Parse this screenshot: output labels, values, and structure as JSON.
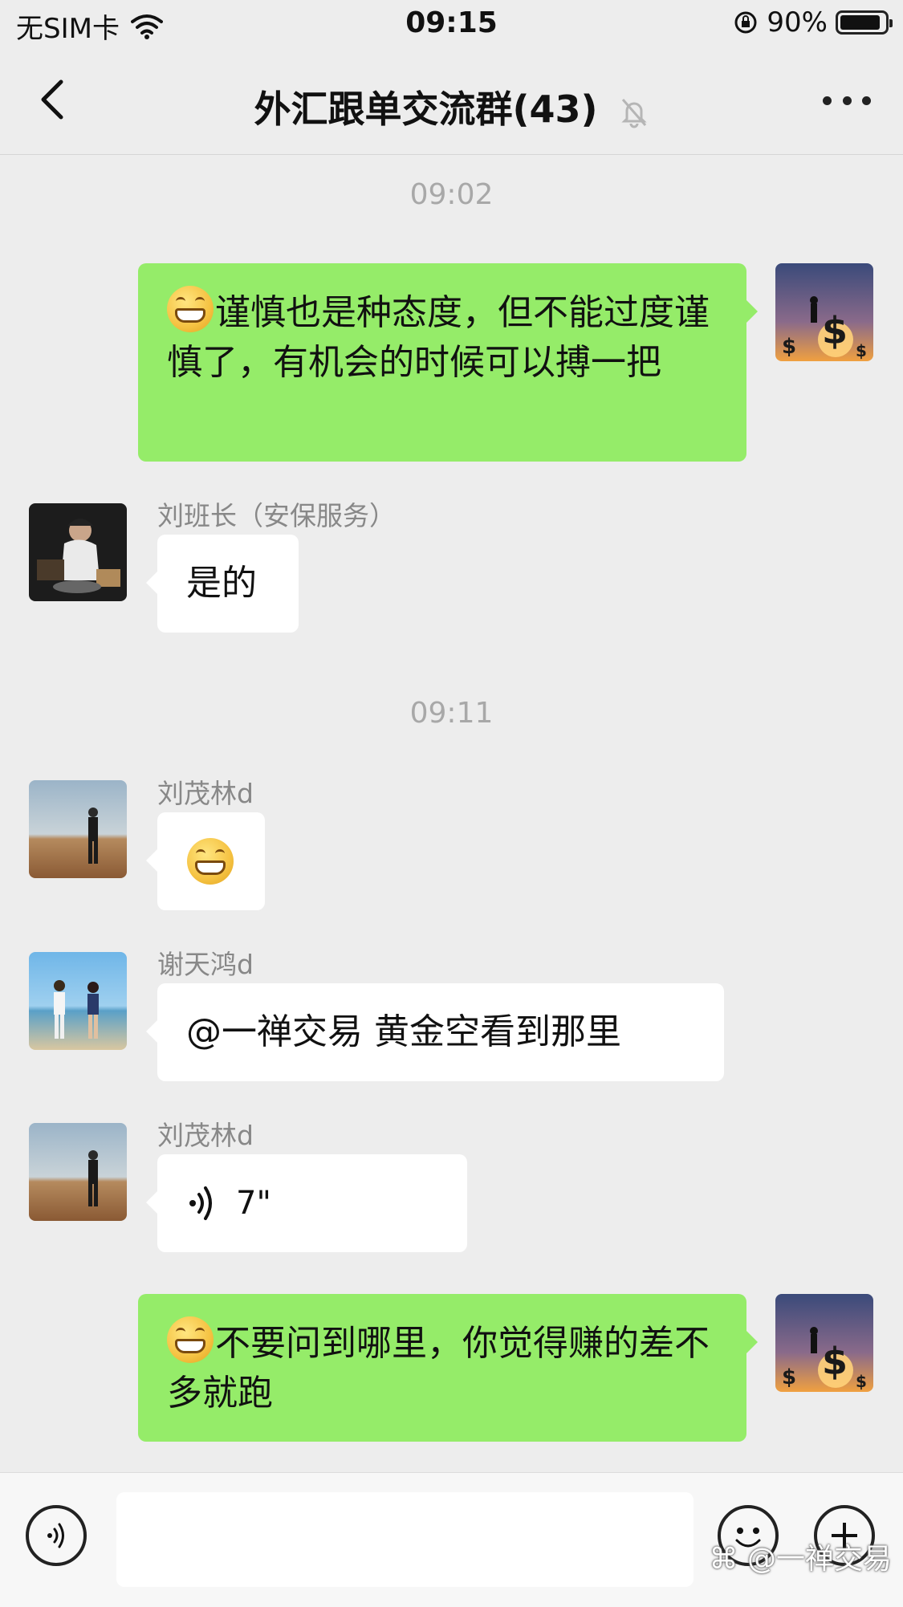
{
  "status_bar": {
    "carrier": "无SIM卡",
    "time": "09:15",
    "battery": "90%",
    "battery_level": 0.9
  },
  "nav": {
    "title": "外汇跟单交流群(43)"
  },
  "messages": {
    "ts1": "09:02",
    "m1_text": "谨慎也是种态度，但不能过度谨慎了，有机会的时候可以搏一把",
    "m2_sender": "刘班长（安保服务）",
    "m2_text": "是的",
    "ts2": "09:11",
    "m3_sender": "刘茂林d",
    "m4_sender": "谢天鸿d",
    "m4_text": "@一禅交易 黄金空看到那里",
    "m5_sender": "刘茂林d",
    "m5_duration": "7\"",
    "m6_text": "不要问到哪里，你觉得赚的差不多就跑"
  },
  "watermark": "@一禅交易",
  "colors": {
    "background": "#ededed",
    "outgoing_bubble": "#95ec69",
    "incoming_bubble": "#ffffff"
  }
}
